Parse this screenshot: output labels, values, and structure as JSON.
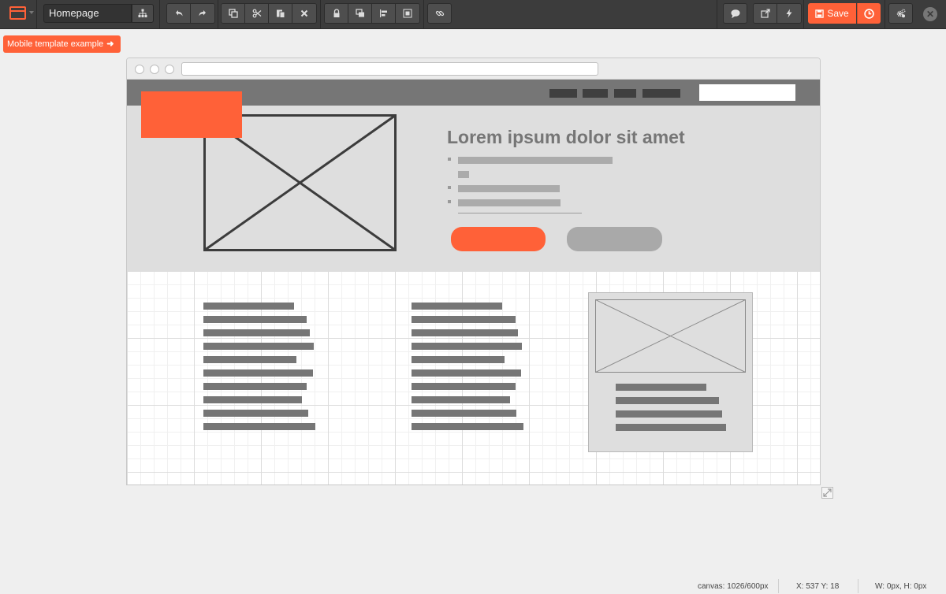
{
  "toolbar": {
    "page_name": "Homepage",
    "save_label": "Save"
  },
  "template_tag": {
    "label": "Mobile template example",
    "arrow": "➜"
  },
  "wireframe": {
    "hero_title": "Lorem ipsum dolor sit amet"
  },
  "status_bar": {
    "canvas": "canvas: 1026/600px",
    "coords": "X: 537 Y: 18",
    "size": "W: 0px, H: 0px"
  },
  "colors": {
    "accent": "#ff6138",
    "toolbar_bg": "#3c3c3c",
    "canvas_bg": "#efefef",
    "wireframe_gray": "#767676"
  }
}
